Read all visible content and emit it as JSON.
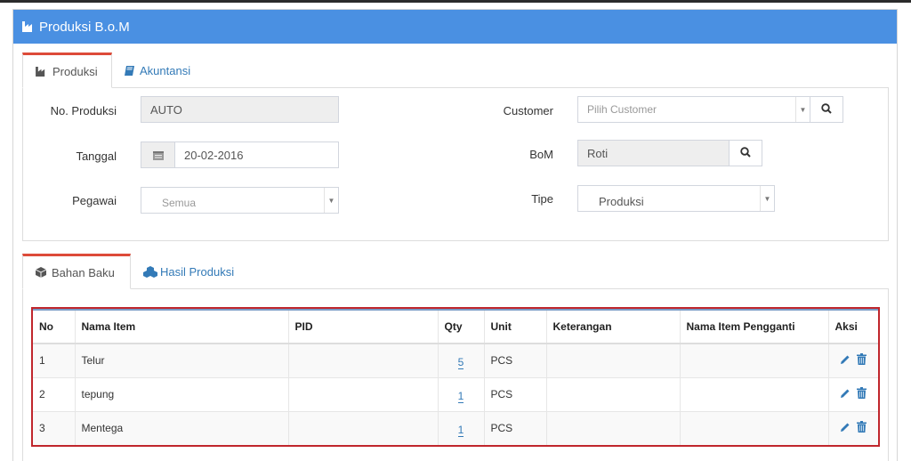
{
  "panel": {
    "title": "Produksi B.o.M"
  },
  "top_tabs": [
    {
      "label": "Produksi",
      "icon": "factory-icon",
      "active": true
    },
    {
      "label": "Akuntansi",
      "icon": "book-icon",
      "active": false
    }
  ],
  "form": {
    "no_produksi": {
      "label": "No. Produksi",
      "value": "AUTO"
    },
    "tanggal": {
      "label": "Tanggal",
      "value": "20-02-2016",
      "icon": "calendar-icon"
    },
    "pegawai": {
      "label": "Pegawai",
      "placeholder": "Semua"
    },
    "customer": {
      "label": "Customer",
      "placeholder": "Pilih Customer",
      "icon": "search-icon"
    },
    "bom": {
      "label": "BoM",
      "value": "Roti",
      "icon": "search-icon"
    },
    "tipe": {
      "label": "Tipe",
      "value": "Produksi"
    }
  },
  "bottom_tabs": [
    {
      "label": "Bahan Baku",
      "icon": "cube-icon",
      "active": true
    },
    {
      "label": "Hasil Produksi",
      "icon": "cubes-icon",
      "active": false
    }
  ],
  "table": {
    "columns": [
      "No",
      "Nama Item",
      "PID",
      "Qty",
      "Unit",
      "Keterangan",
      "Nama Item Pengganti",
      "Aksi"
    ],
    "rows": [
      {
        "no": "1",
        "nama_item": "Telur",
        "pid": "",
        "qty": "5",
        "unit": "PCS",
        "keterangan": "",
        "pengganti": ""
      },
      {
        "no": "2",
        "nama_item": "tepung",
        "pid": "",
        "qty": "1",
        "unit": "PCS",
        "keterangan": "",
        "pengganti": ""
      },
      {
        "no": "3",
        "nama_item": "Mentega",
        "pid": "",
        "qty": "1",
        "unit": "PCS",
        "keterangan": "",
        "pengganti": ""
      }
    ],
    "action_icons": [
      "pencil-icon",
      "trash-icon"
    ]
  },
  "colors": {
    "header": "#4a90e2",
    "active_tab_border": "#dd4b39",
    "highlight_border": "#c0262c",
    "link": "#337ab7"
  }
}
